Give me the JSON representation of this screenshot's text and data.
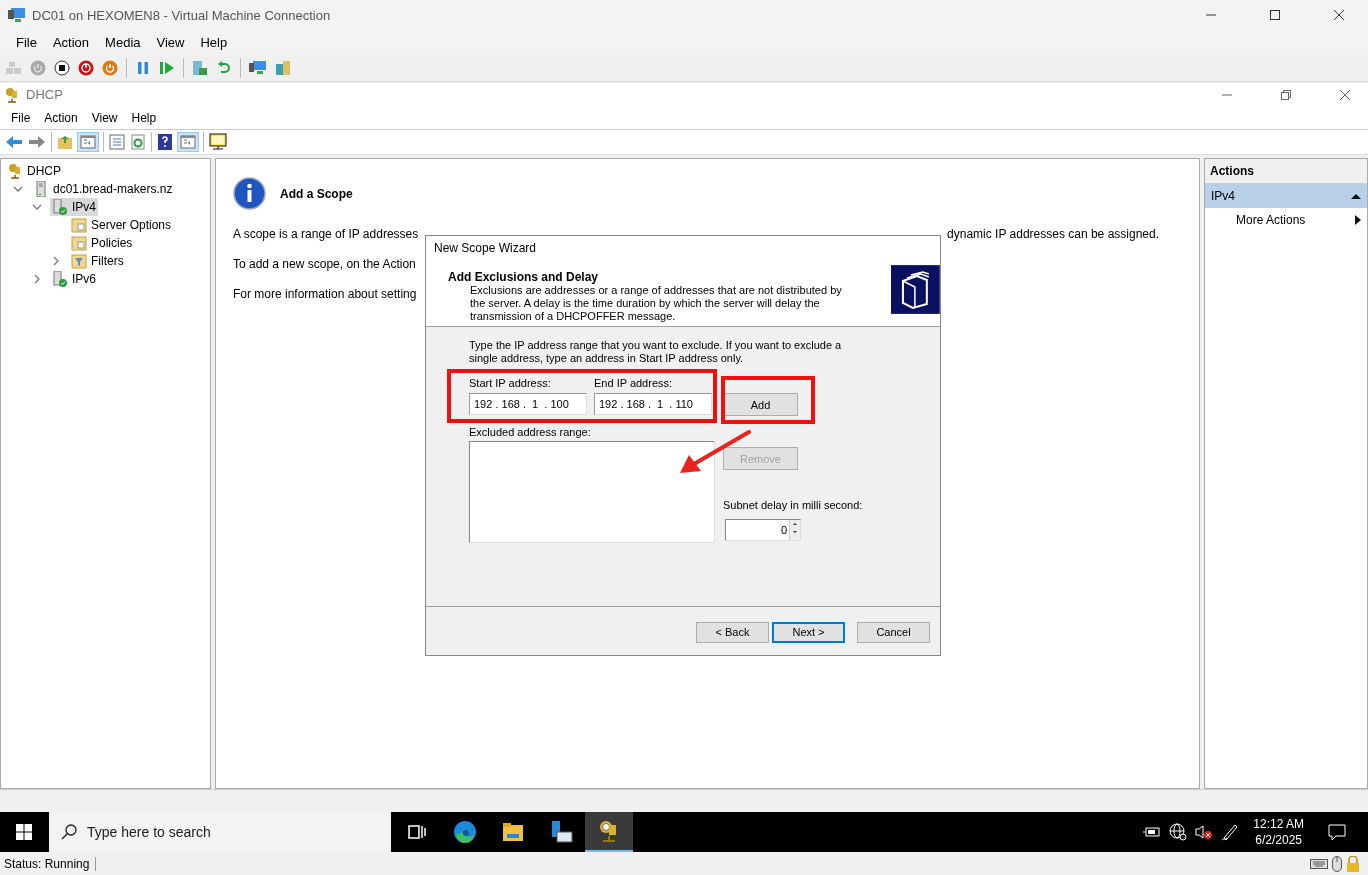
{
  "vm_window": {
    "title": "DC01 on HEXOMEN8 - Virtual Machine Connection",
    "menu": [
      "File",
      "Action",
      "Media",
      "View",
      "Help"
    ]
  },
  "dhcp_window": {
    "title": "DHCP",
    "menu": [
      "File",
      "Action",
      "View",
      "Help"
    ]
  },
  "tree": [
    {
      "label": "DHCP",
      "kind": "root",
      "selected": false,
      "children": [
        {
          "label": "dc01.bread-makers.nz",
          "kind": "server",
          "selected": false,
          "expanded": true,
          "children": [
            {
              "label": "IPv4",
              "kind": "protocol",
              "selected": true,
              "expanded": true,
              "children": [
                {
                  "label": "Server Options",
                  "kind": "options",
                  "selected": false
                },
                {
                  "label": "Policies",
                  "kind": "policies",
                  "selected": false
                },
                {
                  "label": "Filters",
                  "kind": "filters",
                  "selected": false,
                  "expanded": false
                }
              ]
            },
            {
              "label": "IPv6",
              "kind": "protocol",
              "selected": false,
              "expanded": false
            }
          ]
        }
      ]
    }
  ],
  "content": {
    "heading": "Add a Scope",
    "lines": [
      {
        "left": "A scope is a range of IP addresses",
        "right": "dynamic IP addresses can be assigned."
      },
      {
        "left": "To add a new scope, on the Action"
      },
      {
        "left": "For more information about setting"
      }
    ]
  },
  "wizard": {
    "title": "New Scope Wizard",
    "heading": "Add Exclusions and Delay",
    "description": "Exclusions are addresses or a range of addresses that are not distributed by the server. A delay is the time duration by which the server will delay the transmission of a DHCPOFFER message.",
    "instruction": "Type the IP address range that you want to exclude. If you want to exclude a single address, type an address in Start IP address only.",
    "start_label": "Start IP address:",
    "start_value": "192 . 168 .  1  . 100",
    "end_label": "End IP address:",
    "end_value": "192 . 168 .  1  . 110",
    "add_button": "Add",
    "excluded_label": "Excluded address range:",
    "remove_button": {
      "label": "Remove",
      "disabled": true
    },
    "delay_label": "Subnet delay in milli second:",
    "delay_value": "0",
    "buttons": [
      {
        "label": "< Back",
        "default": false
      },
      {
        "label": "Next >",
        "default": true
      },
      {
        "label": "Cancel",
        "default": false
      }
    ]
  },
  "actions": {
    "title": "Actions",
    "section": {
      "label": "IPv4",
      "expanded": true
    },
    "items": [
      {
        "label": "More Actions"
      }
    ]
  },
  "taskbar": {
    "search": {
      "placeholder": "Type here to search"
    },
    "apps": [
      {
        "kind": "task-view",
        "selected": false
      },
      {
        "kind": "edge",
        "selected": false
      },
      {
        "kind": "explorer",
        "selected": false
      },
      {
        "kind": "server-manager",
        "selected": false
      },
      {
        "kind": "dhcp",
        "selected": true
      }
    ],
    "time": "12:12 AM",
    "date": "6/2/2025"
  },
  "status_bar": {
    "text": "Status: Running"
  }
}
